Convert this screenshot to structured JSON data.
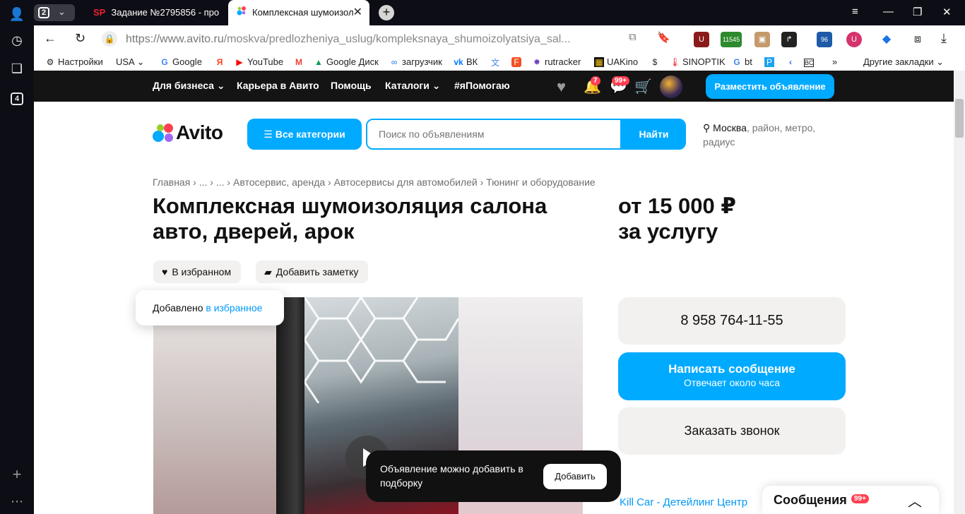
{
  "browser": {
    "tab_count": "2",
    "tabs": [
      {
        "favicon": "SP",
        "title": "Задание №2795856 - про"
      },
      {
        "title": "Комплексная шумоизол"
      }
    ],
    "url_host": "https://www.avito.ru",
    "url_path": "/moskva/predlozheniya_uslug/kompleksnaya_shumoizolyatsiya_sal...",
    "ext_badge_1": "11545",
    "ext_badge_2": "96",
    "sidebar_counter": "4",
    "bookmarks": [
      "Настройки",
      "USA",
      "Google",
      "YouTube",
      "Google Диск",
      "загрузчик",
      "ВК",
      "rutracker",
      "UAKino",
      "SINOPTIK",
      "bt"
    ],
    "other_bookmarks": "Другие закладки"
  },
  "avito": {
    "colors": {
      "accent": "#00aaff",
      "dark": "#141414",
      "badge": "#ff4053"
    },
    "topnav": {
      "business": "Для бизнеса",
      "career": "Карьера в Авито",
      "help": "Помощь",
      "catalogs": "Каталоги",
      "ihelp": "#яПомогаю",
      "notif_badge": "7",
      "msg_badge": "99+",
      "post_ad": "Разместить объявление"
    },
    "logo": "Avito",
    "all_categories": "Все категории",
    "search_placeholder": "Поиск по объявлениям",
    "search_button": "Найти",
    "location_city": "Москва",
    "location_rest": ", район, метро, радиус",
    "breadcrumbs": [
      "Главная",
      "...",
      "...",
      "Автосервис, аренда",
      "Автосервисы для автомобилей",
      "Тюнинг и оборудование"
    ],
    "title": "Комплексная шумоизоляция салона авто, дверей, арок",
    "price_line1": "от 15 000 ₽",
    "price_line2": "за услугу",
    "fav_button": "В избранном",
    "note_button": "Добавить заметку",
    "fav_tooltip_prefix": "Добавлено ",
    "fav_tooltip_link": "в избранное",
    "phone": "8 958 764-11-55",
    "message_button": "Написать сообщение",
    "message_sub": "Отвечает около часа",
    "call_button": "Заказать звонок",
    "seller": "Kill Car - Детейлинг Центр",
    "toast_text": "Объявление можно добавить в подборку",
    "toast_button": "Добавить",
    "messenger_title": "Сообщения",
    "messenger_badge": "99+"
  }
}
